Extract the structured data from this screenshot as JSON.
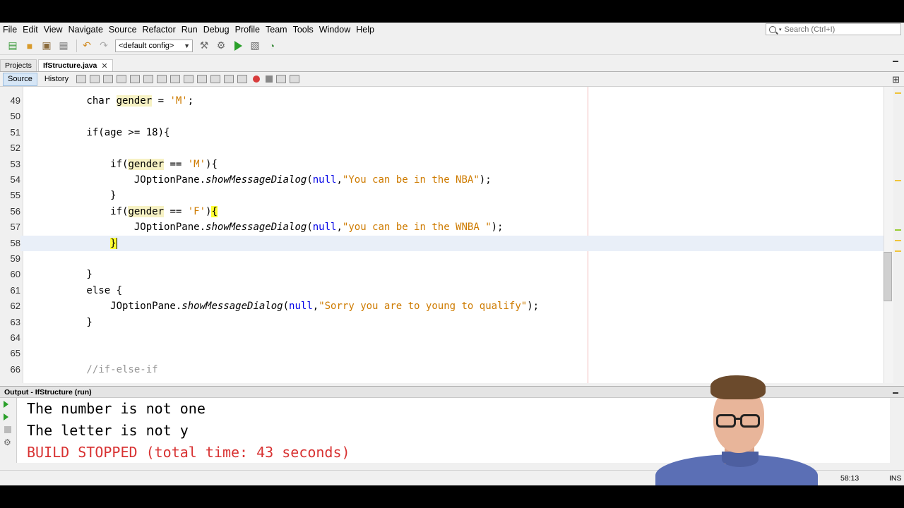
{
  "menu": [
    "File",
    "Edit",
    "View",
    "Navigate",
    "Source",
    "Refactor",
    "Run",
    "Debug",
    "Profile",
    "Team",
    "Tools",
    "Window",
    "Help"
  ],
  "search": {
    "placeholder": "Search (Ctrl+I)"
  },
  "toolbar": {
    "config": "<default config>"
  },
  "tabs": {
    "projects": "Projects",
    "file": "IfStructure.java"
  },
  "editor_tabs": {
    "source": "Source",
    "history": "History"
  },
  "code_lines": [
    {
      "num": "49",
      "parts": [
        [
          "",
          "        char "
        ],
        [
          "hl",
          "gender"
        ],
        [
          "",
          " = "
        ],
        [
          "str",
          "'M'"
        ],
        [
          "",
          ";"
        ]
      ]
    },
    {
      "num": "50",
      "parts": []
    },
    {
      "num": "51",
      "parts": [
        [
          "",
          "        if(age >= 18){"
        ]
      ]
    },
    {
      "num": "52",
      "parts": []
    },
    {
      "num": "53",
      "parts": [
        [
          "",
          "            if("
        ],
        [
          "hl",
          "gender"
        ],
        [
          "",
          " == "
        ],
        [
          "str",
          "'M'"
        ],
        [
          "",
          "){"
        ]
      ]
    },
    {
      "num": "54",
      "parts": [
        [
          "",
          "                JOptionPane."
        ],
        [
          "it",
          "showMessageDialog"
        ],
        [
          "",
          "("
        ],
        [
          "nl",
          "null"
        ],
        [
          "",
          ","
        ],
        [
          "str",
          "\"You can be in the NBA\""
        ],
        [
          "",
          ");"
        ]
      ]
    },
    {
      "num": "55",
      "parts": [
        [
          "",
          "            }"
        ]
      ]
    },
    {
      "num": "56",
      "parts": [
        [
          "",
          "            if("
        ],
        [
          "hl",
          "gender"
        ],
        [
          "",
          " == "
        ],
        [
          "str",
          "'F'"
        ],
        [
          "",
          ")"
        ],
        [
          "brace",
          "{"
        ]
      ]
    },
    {
      "num": "57",
      "parts": [
        [
          "",
          "                JOptionPane."
        ],
        [
          "it",
          "showMessageDialog"
        ],
        [
          "",
          "("
        ],
        [
          "nl",
          "null"
        ],
        [
          "",
          ","
        ],
        [
          "str",
          "\"you can be in the WNBA \""
        ],
        [
          "",
          ");"
        ]
      ]
    },
    {
      "num": "58",
      "parts": [
        [
          "",
          "            "
        ],
        [
          "brace",
          "}"
        ],
        [
          "cursor",
          ""
        ]
      ],
      "current": true
    },
    {
      "num": "59",
      "parts": []
    },
    {
      "num": "60",
      "parts": [
        [
          "",
          "        }"
        ]
      ]
    },
    {
      "num": "61",
      "parts": [
        [
          "",
          "        else {"
        ]
      ]
    },
    {
      "num": "62",
      "parts": [
        [
          "",
          "            JOptionPane."
        ],
        [
          "it",
          "showMessageDialog"
        ],
        [
          "",
          "("
        ],
        [
          "nl",
          "null"
        ],
        [
          "",
          ","
        ],
        [
          "str",
          "\"Sorry you are to young to qualify\""
        ],
        [
          "",
          ");"
        ]
      ]
    },
    {
      "num": "63",
      "parts": [
        [
          "",
          "        }"
        ]
      ]
    },
    {
      "num": "64",
      "parts": []
    },
    {
      "num": "65",
      "parts": []
    },
    {
      "num": "66",
      "parts": [
        [
          "cmt",
          "        //if-else-if"
        ]
      ]
    }
  ],
  "output": {
    "title": "Output - IfStructure (run)",
    "lines": [
      "The number is not one",
      "The letter is not y"
    ],
    "build_status": "BUILD STOPPED (total time: 43 seconds)"
  },
  "status": {
    "position": "58:13",
    "mode": "INS"
  },
  "colors": {
    "string": "#ce7b00",
    "null_keyword": "#0000e6",
    "build_stopped": "#d83232",
    "run_green": "#2aa02a"
  }
}
